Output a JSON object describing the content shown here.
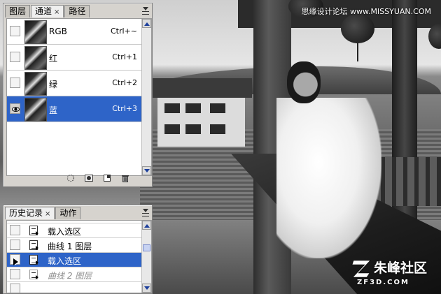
{
  "watermark": {
    "top": "思缘设计论坛 www.MISSYUAN.COM",
    "brand_cn": "朱峰社区",
    "brand_en": "ZF3D.COM"
  },
  "channels_panel": {
    "tabs": [
      {
        "label": "图层",
        "active": false
      },
      {
        "label": "通道",
        "active": true,
        "close": "×"
      },
      {
        "label": "路径",
        "active": false
      }
    ],
    "rows": [
      {
        "name": "RGB",
        "shortcut": "Ctrl+~",
        "visible": false,
        "selected": false
      },
      {
        "name": "红",
        "shortcut": "Ctrl+1",
        "visible": false,
        "selected": false
      },
      {
        "name": "绿",
        "shortcut": "Ctrl+2",
        "visible": false,
        "selected": false
      },
      {
        "name": "蓝",
        "shortcut": "Ctrl+3",
        "visible": true,
        "selected": true
      }
    ],
    "footer_icons": [
      "dotted-circle-icon",
      "mask-icon",
      "new-channel-icon",
      "trash-icon"
    ]
  },
  "history_panel": {
    "tabs": [
      {
        "label": "历史记录",
        "active": true,
        "close": "×"
      },
      {
        "label": "动作",
        "active": false
      }
    ],
    "rows": [
      {
        "name": "载入选区",
        "state": "normal"
      },
      {
        "name": "曲线 1 图层",
        "state": "normal"
      },
      {
        "name": "载入选区",
        "state": "selected"
      },
      {
        "name": "曲线 2 图层",
        "state": "dimmed"
      }
    ]
  },
  "colors": {
    "selection": "#2e64c8",
    "panel_bg": "#d6d3ce"
  }
}
